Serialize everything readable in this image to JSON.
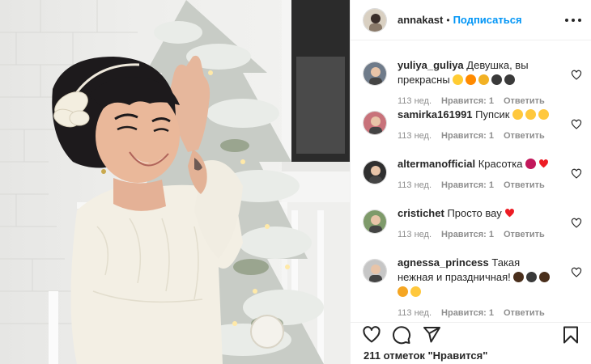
{
  "post": {
    "author": "annakast",
    "separator": "•",
    "follow_label": "Подписаться",
    "likes_text": "211 отметок \"Нравится\""
  },
  "colors": {
    "accent": "#0095f6",
    "muted": "#8e8e8e",
    "text": "#262626",
    "heart_red": "#ed1c24"
  },
  "icons": {
    "more": "more-options-icon",
    "like": "heart-outline-icon",
    "comment": "speech-bubble-icon",
    "share": "paper-plane-icon",
    "save": "bookmark-icon"
  },
  "comments": [
    {
      "username": "yuliya_guliya",
      "text": "Девушка, вы прекрасны",
      "emojis": [
        "grinning-heart-eyes",
        "collision",
        "party-popper",
        "sparkling-face",
        "sparkling-face"
      ],
      "age": "113 нед.",
      "likes": "Нравится: 1",
      "reply": "Ответить"
    },
    {
      "username": "samirka161991",
      "text": "Пупсик",
      "emojis": [
        "face-savoring",
        "face-blowing-kiss",
        "heart-eyes"
      ],
      "age": "113 нед.",
      "likes": "Нравится: 1",
      "reply": "Ответить"
    },
    {
      "username": "altermanofficial",
      "text": "Красотка",
      "emojis": [
        "smiling-devil",
        "red-heart"
      ],
      "age": "113 нед.",
      "likes": "Нравится: 1",
      "reply": "Ответить"
    },
    {
      "username": "cristichet",
      "text": "Просто вау",
      "emojis": [
        "red-heart"
      ],
      "age": "113 нед.",
      "likes": "Нравится: 1",
      "reply": "Ответить"
    },
    {
      "username": "agnessa_princess",
      "text": "Такая нежная и праздничная!",
      "emojis": [
        "sparkles",
        "sparkling-face",
        "sparkles",
        "heart-eyes-cat",
        "blush"
      ],
      "age": "113 нед.",
      "likes": "Нравится: 1",
      "reply": "Ответить"
    }
  ]
}
